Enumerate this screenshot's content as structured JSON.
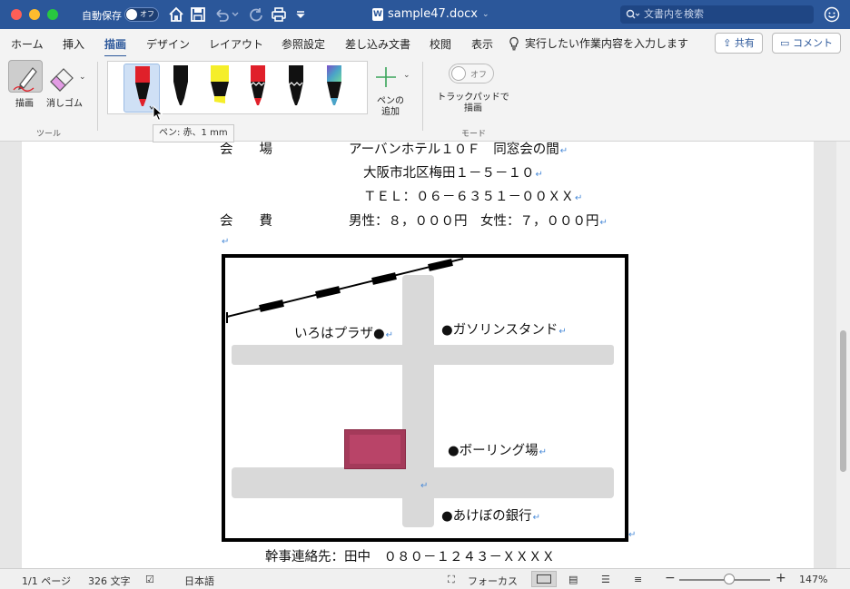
{
  "titlebar": {
    "autosave_label": "自動保存",
    "autosave_state": "オフ",
    "doc_title": "sample47.docx",
    "search_placeholder": "文書内を検索"
  },
  "tabs": [
    "ホーム",
    "挿入",
    "描画",
    "デザイン",
    "レイアウト",
    "参照設定",
    "差し込み文書",
    "校閲",
    "表示"
  ],
  "active_tab": "描画",
  "tell_me": "実行したい作業内容を入力します",
  "share_label": "共有",
  "comment_label": "コメント",
  "ribbon": {
    "tools": {
      "draw": "描画",
      "eraser": "消しゴム",
      "group": "ツール"
    },
    "pens": [
      {
        "name": "red-pen",
        "color": "#e0202a"
      },
      {
        "name": "black-pen",
        "color": "#111111"
      },
      {
        "name": "yellow-highlighter",
        "color": "#f5ee2a"
      },
      {
        "name": "red-pencil",
        "color": "#e0202a"
      },
      {
        "name": "black-pencil",
        "color": "#111111"
      },
      {
        "name": "galaxy-pen",
        "color": "#4aa3c8"
      }
    ],
    "add_pen": "ペンの追加",
    "trackpad_toggle": "オフ",
    "trackpad_label": "トラックパッドで描画",
    "mode_group": "モード"
  },
  "tooltip": "ペン: 赤、1 mm",
  "document": {
    "venue_label": "会　　場",
    "venue_value": "アーバンホテル１０Ｆ　同窓会の間",
    "address": "大阪市北区梅田１－５－１０",
    "tel": "ＴＥＬ：０６－６３５１－００ＸＸ",
    "fee_label": "会　　費",
    "fee_value": "男性：８，０００円　女性：７，０００円",
    "map": {
      "iroha": "いろはプラザ●",
      "gas": "●ガソリンスタンド",
      "bowling": "●ボーリング場",
      "bank": "●あけぼの銀行"
    },
    "contact": "幹事連絡先：田中　０８０－１２４３－ＸＸＸＸ"
  },
  "status": {
    "page": "1/1 ページ",
    "words": "326 文字",
    "language": "日本語",
    "focus": "フォーカス",
    "zoom": "147%"
  }
}
